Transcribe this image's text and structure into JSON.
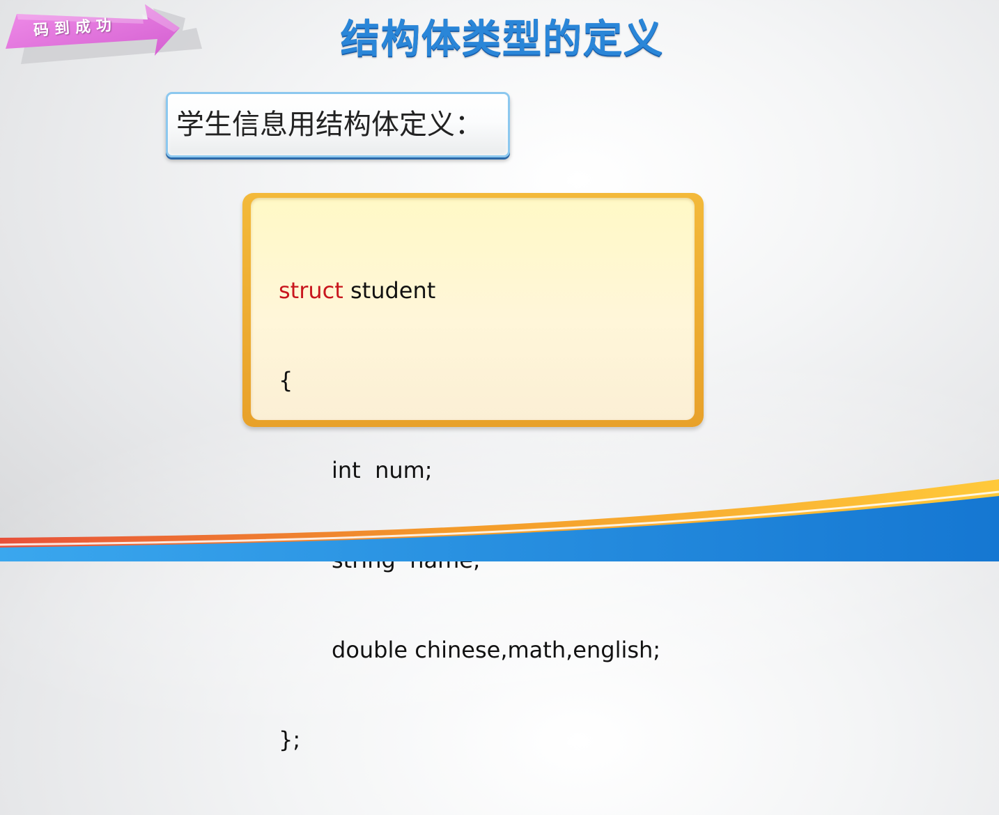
{
  "brand": {
    "label": "码到成功",
    "color": "#e47be0"
  },
  "slide": {
    "title": "结构体类型的定义",
    "label": "学生信息用结构体定义："
  },
  "code": {
    "keyword": "struct",
    "line1_rest": " student",
    "line2": "{",
    "line3": "int  num;",
    "line4": "string  name;",
    "line5": "double chinese,math,english;",
    "line6": "};"
  },
  "colors": {
    "title": "#2a86d8",
    "keyword": "#c8161d",
    "panel_border": "#f0b335",
    "panel_fill": "#fff7cf",
    "band_orange": "#f6a623",
    "band_blue": "#1e8fe0"
  }
}
